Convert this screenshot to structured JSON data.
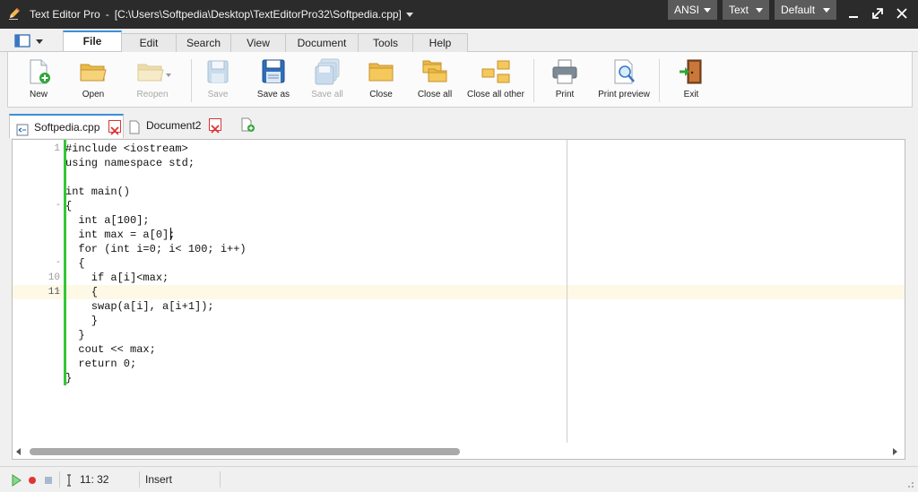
{
  "titlebar": {
    "app_name": "Text Editor Pro",
    "separator": "-",
    "path": "[C:\\Users\\Softpedia\\Desktop\\TextEditorPro32\\Softpedia.cpp]",
    "encoding_label": "ANSI",
    "mode_label": "Text",
    "style_label": "Default"
  },
  "ribbon_tabs": [
    "File",
    "Edit",
    "Search",
    "View",
    "Document",
    "Tools",
    "Help"
  ],
  "active_ribbon_tab": "File",
  "ribbon": {
    "new": "New",
    "open": "Open",
    "reopen": "Reopen",
    "save": "Save",
    "save_as": "Save as",
    "save_all": "Save all",
    "close": "Close",
    "close_all": "Close all",
    "close_all_other": "Close all other",
    "print": "Print",
    "print_preview": "Print preview",
    "exit": "Exit"
  },
  "documents": [
    {
      "name": "Softpedia.cpp",
      "active": true
    },
    {
      "name": "Document2",
      "active": false
    }
  ],
  "editor": {
    "lines": [
      {
        "num": "1",
        "fold": "",
        "text": "#include <iostream>"
      },
      {
        "num": "",
        "fold": "",
        "text": "using namespace std;"
      },
      {
        "num": "",
        "fold": "",
        "text": ""
      },
      {
        "num": "",
        "fold": "",
        "text": "int main()"
      },
      {
        "num": "",
        "fold": "-",
        "text": "{"
      },
      {
        "num": "",
        "fold": "",
        "text": "  int a[100];"
      },
      {
        "num": "",
        "fold": "",
        "text": "  int max = a[0];"
      },
      {
        "num": "",
        "fold": "",
        "text": "  for (int i=0; i< 100; i++)"
      },
      {
        "num": "",
        "fold": "-",
        "text": "  {"
      },
      {
        "num": "10",
        "fold": "",
        "text": "    if a[i]<max;"
      },
      {
        "num": "11",
        "fold": "-",
        "text": "    {"
      },
      {
        "num": "",
        "fold": "",
        "text": "    swap(a[i], a[i+1]);"
      },
      {
        "num": "",
        "fold": "",
        "text": "    }"
      },
      {
        "num": "",
        "fold": "",
        "text": "  }"
      },
      {
        "num": "",
        "fold": "",
        "text": "  cout << max;"
      },
      {
        "num": "",
        "fold": "",
        "text": "  return 0;"
      },
      {
        "num": "",
        "fold": "",
        "text": "}"
      }
    ],
    "current_line": 11
  },
  "status": {
    "position": "11: 32",
    "mode": "Insert"
  },
  "colors": {
    "accent": "#3a8fd6",
    "fold_bar": "#35c735",
    "current_line_bg": "#fdf9e6",
    "titlebar_bg": "#2b2b2b"
  }
}
